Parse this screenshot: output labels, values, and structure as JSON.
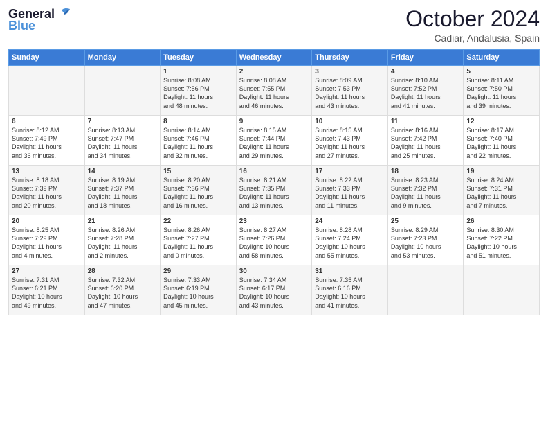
{
  "logo": {
    "line1": "General",
    "line2": "Blue"
  },
  "title": "October 2024",
  "subtitle": "Cadiar, Andalusia, Spain",
  "headers": [
    "Sunday",
    "Monday",
    "Tuesday",
    "Wednesday",
    "Thursday",
    "Friday",
    "Saturday"
  ],
  "weeks": [
    [
      {
        "day": "",
        "text": ""
      },
      {
        "day": "",
        "text": ""
      },
      {
        "day": "1",
        "text": "Sunrise: 8:08 AM\nSunset: 7:56 PM\nDaylight: 11 hours\nand 48 minutes."
      },
      {
        "day": "2",
        "text": "Sunrise: 8:08 AM\nSunset: 7:55 PM\nDaylight: 11 hours\nand 46 minutes."
      },
      {
        "day": "3",
        "text": "Sunrise: 8:09 AM\nSunset: 7:53 PM\nDaylight: 11 hours\nand 43 minutes."
      },
      {
        "day": "4",
        "text": "Sunrise: 8:10 AM\nSunset: 7:52 PM\nDaylight: 11 hours\nand 41 minutes."
      },
      {
        "day": "5",
        "text": "Sunrise: 8:11 AM\nSunset: 7:50 PM\nDaylight: 11 hours\nand 39 minutes."
      }
    ],
    [
      {
        "day": "6",
        "text": "Sunrise: 8:12 AM\nSunset: 7:49 PM\nDaylight: 11 hours\nand 36 minutes."
      },
      {
        "day": "7",
        "text": "Sunrise: 8:13 AM\nSunset: 7:47 PM\nDaylight: 11 hours\nand 34 minutes."
      },
      {
        "day": "8",
        "text": "Sunrise: 8:14 AM\nSunset: 7:46 PM\nDaylight: 11 hours\nand 32 minutes."
      },
      {
        "day": "9",
        "text": "Sunrise: 8:15 AM\nSunset: 7:44 PM\nDaylight: 11 hours\nand 29 minutes."
      },
      {
        "day": "10",
        "text": "Sunrise: 8:15 AM\nSunset: 7:43 PM\nDaylight: 11 hours\nand 27 minutes."
      },
      {
        "day": "11",
        "text": "Sunrise: 8:16 AM\nSunset: 7:42 PM\nDaylight: 11 hours\nand 25 minutes."
      },
      {
        "day": "12",
        "text": "Sunrise: 8:17 AM\nSunset: 7:40 PM\nDaylight: 11 hours\nand 22 minutes."
      }
    ],
    [
      {
        "day": "13",
        "text": "Sunrise: 8:18 AM\nSunset: 7:39 PM\nDaylight: 11 hours\nand 20 minutes."
      },
      {
        "day": "14",
        "text": "Sunrise: 8:19 AM\nSunset: 7:37 PM\nDaylight: 11 hours\nand 18 minutes."
      },
      {
        "day": "15",
        "text": "Sunrise: 8:20 AM\nSunset: 7:36 PM\nDaylight: 11 hours\nand 16 minutes."
      },
      {
        "day": "16",
        "text": "Sunrise: 8:21 AM\nSunset: 7:35 PM\nDaylight: 11 hours\nand 13 minutes."
      },
      {
        "day": "17",
        "text": "Sunrise: 8:22 AM\nSunset: 7:33 PM\nDaylight: 11 hours\nand 11 minutes."
      },
      {
        "day": "18",
        "text": "Sunrise: 8:23 AM\nSunset: 7:32 PM\nDaylight: 11 hours\nand 9 minutes."
      },
      {
        "day": "19",
        "text": "Sunrise: 8:24 AM\nSunset: 7:31 PM\nDaylight: 11 hours\nand 7 minutes."
      }
    ],
    [
      {
        "day": "20",
        "text": "Sunrise: 8:25 AM\nSunset: 7:29 PM\nDaylight: 11 hours\nand 4 minutes."
      },
      {
        "day": "21",
        "text": "Sunrise: 8:26 AM\nSunset: 7:28 PM\nDaylight: 11 hours\nand 2 minutes."
      },
      {
        "day": "22",
        "text": "Sunrise: 8:26 AM\nSunset: 7:27 PM\nDaylight: 11 hours\nand 0 minutes."
      },
      {
        "day": "23",
        "text": "Sunrise: 8:27 AM\nSunset: 7:26 PM\nDaylight: 10 hours\nand 58 minutes."
      },
      {
        "day": "24",
        "text": "Sunrise: 8:28 AM\nSunset: 7:24 PM\nDaylight: 10 hours\nand 55 minutes."
      },
      {
        "day": "25",
        "text": "Sunrise: 8:29 AM\nSunset: 7:23 PM\nDaylight: 10 hours\nand 53 minutes."
      },
      {
        "day": "26",
        "text": "Sunrise: 8:30 AM\nSunset: 7:22 PM\nDaylight: 10 hours\nand 51 minutes."
      }
    ],
    [
      {
        "day": "27",
        "text": "Sunrise: 7:31 AM\nSunset: 6:21 PM\nDaylight: 10 hours\nand 49 minutes."
      },
      {
        "day": "28",
        "text": "Sunrise: 7:32 AM\nSunset: 6:20 PM\nDaylight: 10 hours\nand 47 minutes."
      },
      {
        "day": "29",
        "text": "Sunrise: 7:33 AM\nSunset: 6:19 PM\nDaylight: 10 hours\nand 45 minutes."
      },
      {
        "day": "30",
        "text": "Sunrise: 7:34 AM\nSunset: 6:17 PM\nDaylight: 10 hours\nand 43 minutes."
      },
      {
        "day": "31",
        "text": "Sunrise: 7:35 AM\nSunset: 6:16 PM\nDaylight: 10 hours\nand 41 minutes."
      },
      {
        "day": "",
        "text": ""
      },
      {
        "day": "",
        "text": ""
      }
    ]
  ]
}
